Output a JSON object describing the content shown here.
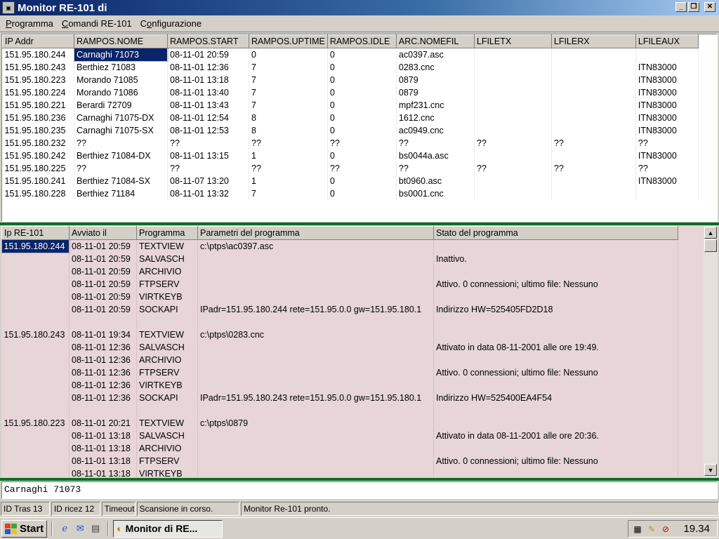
{
  "window": {
    "title": "Monitor RE-101 di"
  },
  "menu": {
    "items": [
      {
        "label": "Programma",
        "underline": "P"
      },
      {
        "label": "Comandi RE-101",
        "underline": "C"
      },
      {
        "label": "Configurazione",
        "underline": "o"
      }
    ]
  },
  "upper_table": {
    "columns": [
      "IP Addr",
      "RAMPOS.NOME",
      "RAMPOS.START",
      "RAMPOS.UPTIME",
      "RAMPOS.IDLE",
      "ARC.NOMEFIL",
      "LFILETX",
      "LFILERX",
      "LFILEAUX"
    ],
    "rows": [
      [
        "151.95.180.244",
        "Carnaghi 71073",
        "08-11-01 20:59",
        "0",
        "0",
        "ac0397.asc",
        "",
        "",
        ""
      ],
      [
        "151.95.180.243",
        "Berthiez 71083",
        "08-11-01 12:36",
        "7",
        "0",
        "0283.cnc",
        "",
        "",
        "ITN83000"
      ],
      [
        "151.95.180.223",
        "Morando 71085",
        "08-11-01 13:18",
        "7",
        "0",
        "0879",
        "",
        "",
        "ITN83000"
      ],
      [
        "151.95.180.224",
        "Morando 71086",
        "08-11-01 13:40",
        "7",
        "0",
        "0879",
        "",
        "",
        "ITN83000"
      ],
      [
        "151.95.180.221",
        "Berardi 72709",
        "08-11-01 13:43",
        "7",
        "0",
        "mpf231.cnc",
        "",
        "",
        "ITN83000"
      ],
      [
        "151.95.180.236",
        "Carnaghi 71075-DX",
        "08-11-01 12:54",
        "8",
        "0",
        "1612.cnc",
        "",
        "",
        "ITN83000"
      ],
      [
        "151.95.180.235",
        "Carnaghi 71075-SX",
        "08-11-01 12:53",
        "8",
        "0",
        "ac0949.cnc",
        "",
        "",
        "ITN83000"
      ],
      [
        "151.95.180.232",
        "??",
        "??",
        "??",
        "??",
        "??",
        "??",
        "??",
        "??"
      ],
      [
        "151.95.180.242",
        "Berthiez 71084-DX",
        "08-11-01 13:15",
        "1",
        "0",
        "bs0044a.asc",
        "",
        "",
        "ITN83000"
      ],
      [
        "151.95.180.225",
        "??",
        "??",
        "??",
        "??",
        "??",
        "??",
        "??",
        "??"
      ],
      [
        "151.95.180.241",
        "Berthiez 71084-SX",
        "08-11-07 13:20",
        "1",
        "0",
        "bt0960.asc",
        "",
        "",
        "ITN83000"
      ],
      [
        "151.95.180.228",
        "Berthiez 71184",
        "08-11-01 13:32",
        "7",
        "0",
        "bs0001.cnc",
        "",
        "",
        ""
      ]
    ]
  },
  "lower_table": {
    "columns": [
      "Ip RE-101",
      "Avviato il",
      "Programma",
      "Parametri del programma",
      "Stato del programma"
    ],
    "rows": [
      [
        "151.95.180.244",
        "08-11-01 20:59",
        "TEXTVIEW",
        "c:\\ptps\\ac0397.asc",
        ""
      ],
      [
        "",
        "08-11-01 20:59",
        "SALVASCH",
        "",
        "Inattivo."
      ],
      [
        "",
        "08-11-01 20:59",
        "ARCHIVIO",
        "",
        ""
      ],
      [
        "",
        "08-11-01 20:59",
        "FTPSERV",
        "",
        "Attivo. 0 connessioni; ultimo file: Nessuno"
      ],
      [
        "",
        "08-11-01 20:59",
        "VIRTKEYB",
        "",
        ""
      ],
      [
        "",
        "08-11-01 20:59",
        "SOCKAPI",
        "IPadr=151.95.180.244 rete=151.95.0.0 gw=151.95.180.1",
        "Indirizzo HW=525405FD2D18"
      ],
      [
        "",
        "",
        "",
        "",
        ""
      ],
      [
        "151.95.180.243",
        "08-11-01 19:34",
        "TEXTVIEW",
        "c:\\ptps\\0283.cnc",
        ""
      ],
      [
        "",
        "08-11-01 12:36",
        "SALVASCH",
        "",
        "Attivato in data 08-11-2001 alle ore 19:49."
      ],
      [
        "",
        "08-11-01 12:36",
        "ARCHIVIO",
        "",
        ""
      ],
      [
        "",
        "08-11-01 12:36",
        "FTPSERV",
        "",
        "Attivo. 0 connessioni; ultimo file: Nessuno"
      ],
      [
        "",
        "08-11-01 12:36",
        "VIRTKEYB",
        "",
        ""
      ],
      [
        "",
        "08-11-01 12:36",
        "SOCKAPI",
        "IPadr=151.95.180.243 rete=151.95.0.0 gw=151.95.180.1",
        "Indirizzo HW=525400EA4F54"
      ],
      [
        "",
        "",
        "",
        "",
        ""
      ],
      [
        "151.95.180.223",
        "08-11-01 20:21",
        "TEXTVIEW",
        "c:\\ptps\\0879",
        ""
      ],
      [
        "",
        "08-11-01 13:18",
        "SALVASCH",
        "",
        "Attivato in data 08-11-2001 alle ore 20:36."
      ],
      [
        "",
        "08-11-01 13:18",
        "ARCHIVIO",
        "",
        ""
      ],
      [
        "",
        "08-11-01 13:18",
        "FTPSERV",
        "",
        "Attivo. 0 connessioni; ultimo file: Nessuno"
      ],
      [
        "",
        "08-11-01 13:18",
        "VIRTKEYB",
        "",
        ""
      ]
    ]
  },
  "edit": {
    "value": "Carnaghi 71073"
  },
  "status": {
    "panels": [
      "ID Tras 13",
      "ID ricez 12",
      "Timeout",
      "Scansione in corso.",
      "Monitor Re-101 pronto."
    ]
  },
  "taskbar": {
    "start_label": "Start",
    "task_label": "Monitor di RE...",
    "clock": "19.34"
  },
  "colors": {
    "title_start": "#0a246a",
    "title_end": "#a6caf0",
    "separator": "#0a6f23",
    "lower_bg": "#e7d5d8",
    "selection": "#0a246a"
  }
}
